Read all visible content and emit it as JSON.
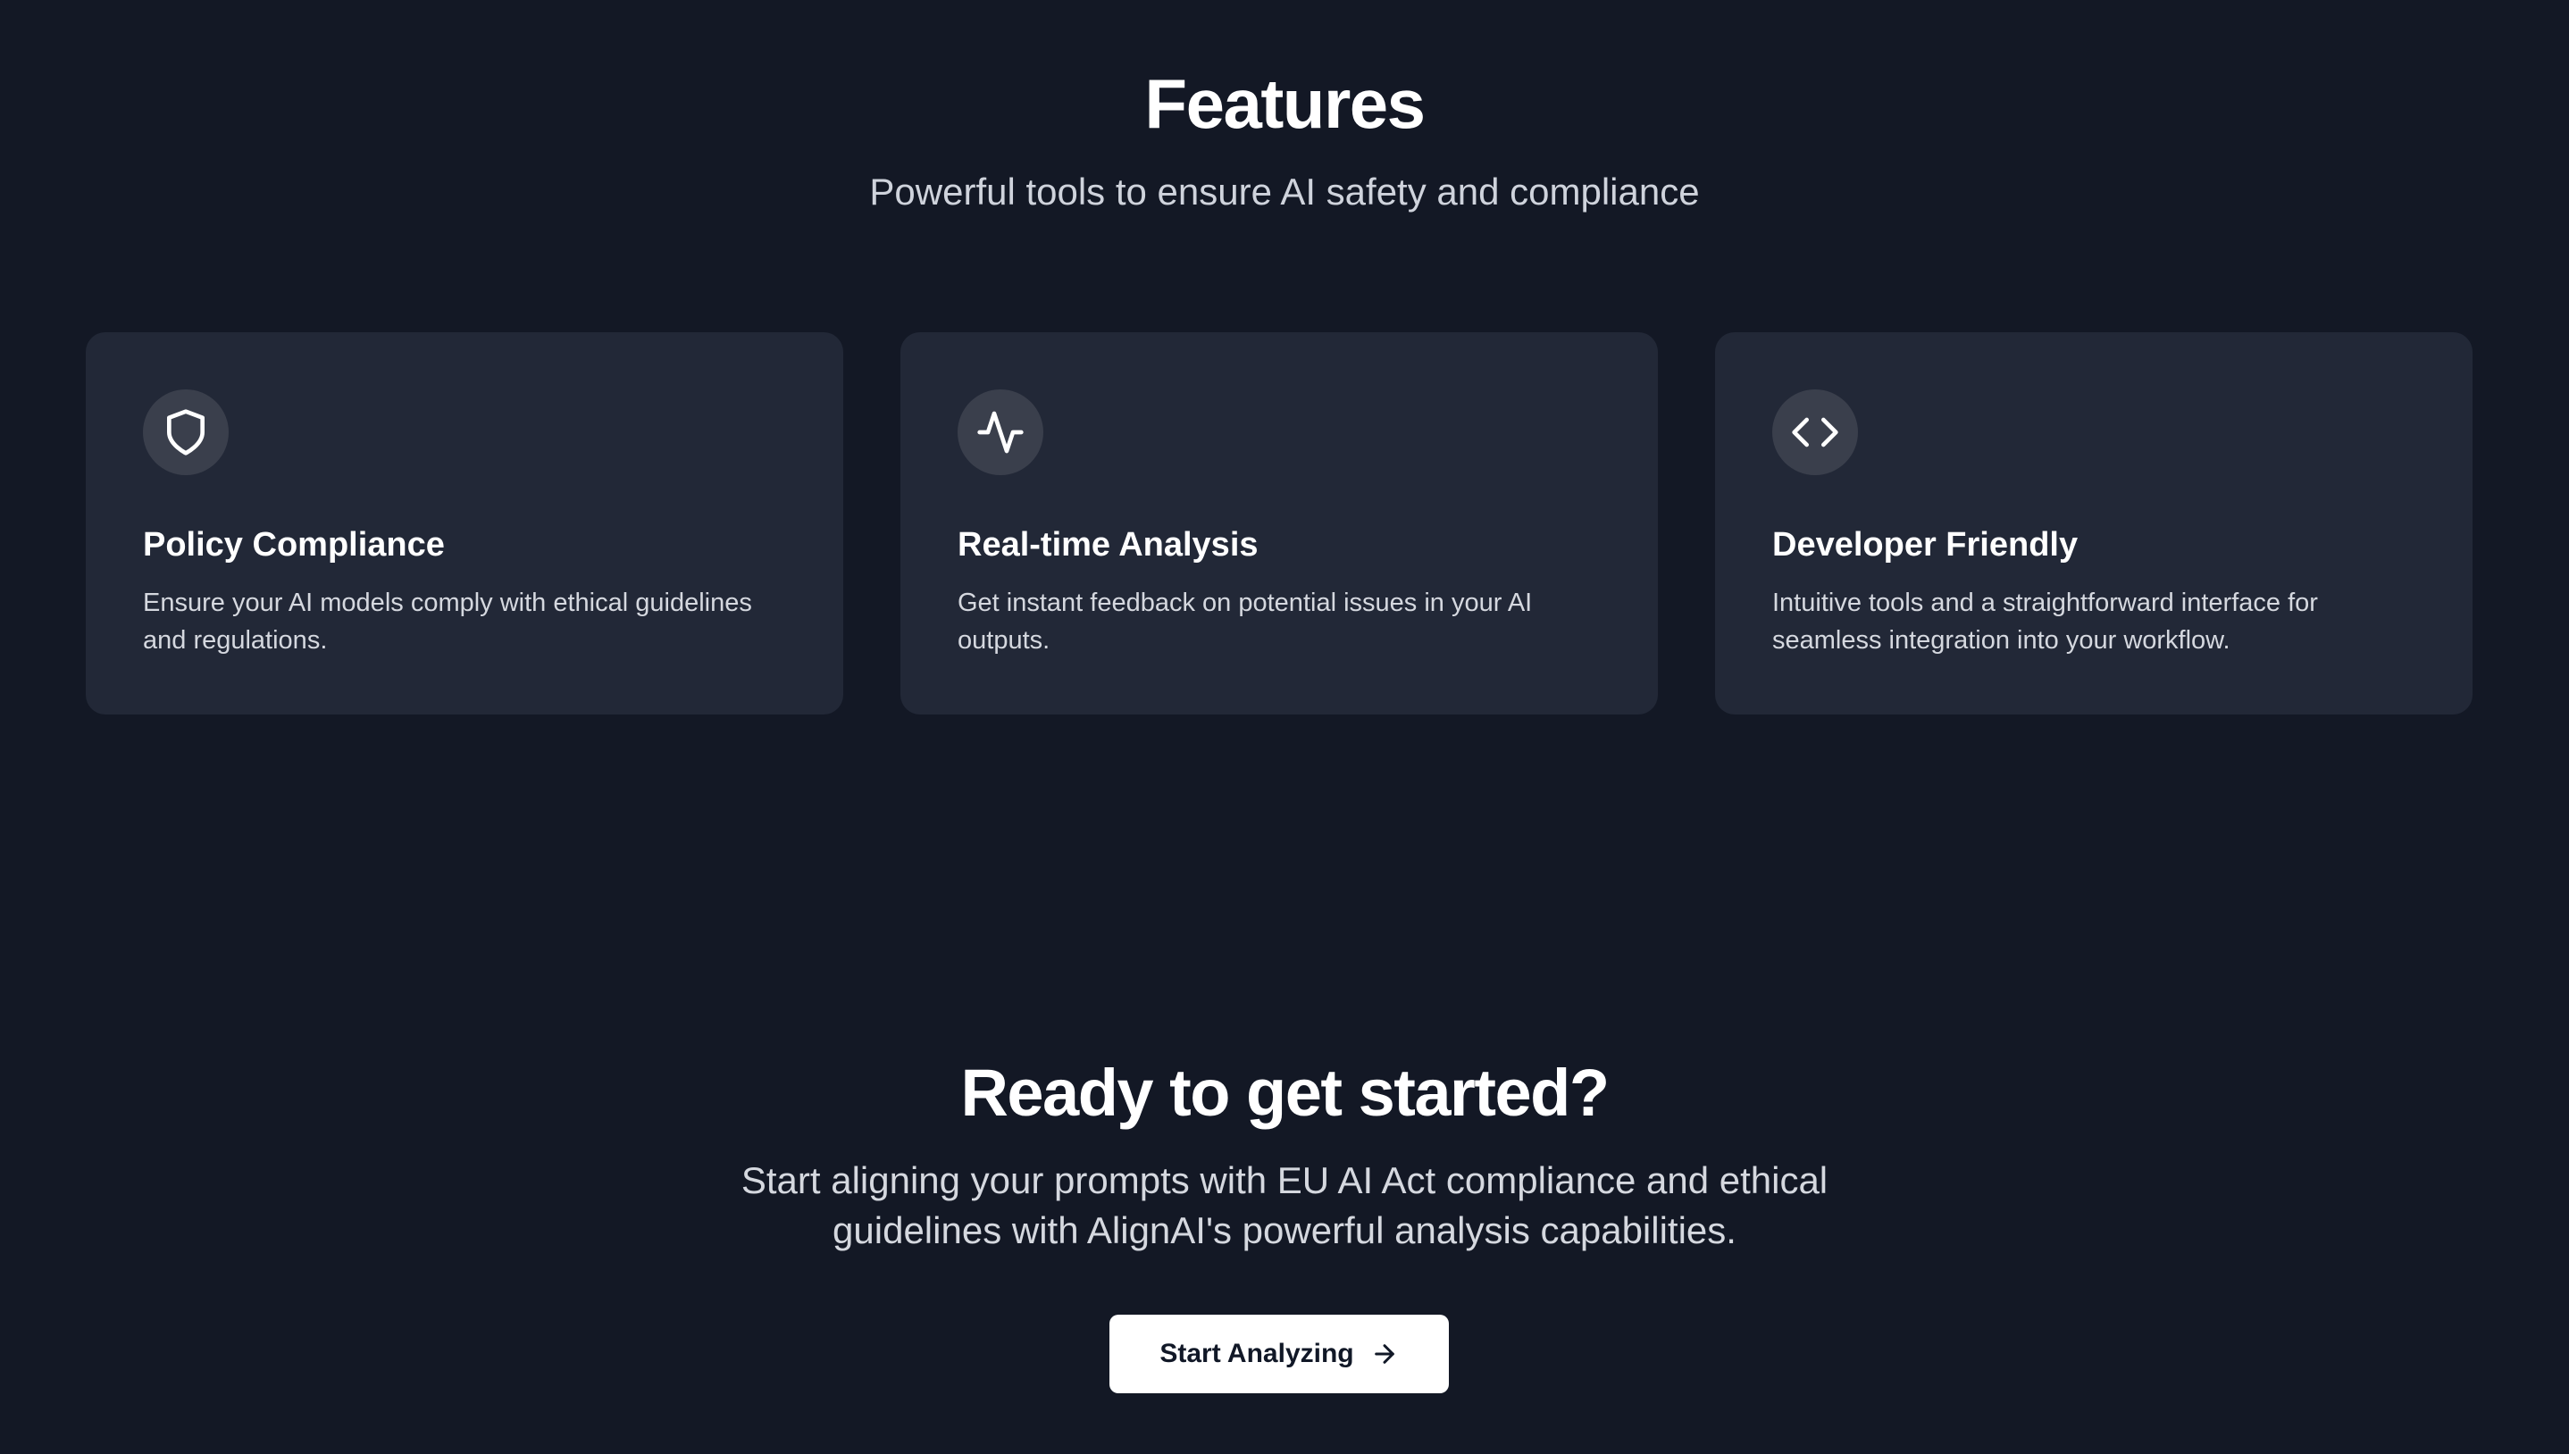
{
  "features": {
    "title": "Features",
    "subtitle": "Powerful tools to ensure AI safety and compliance",
    "cards": [
      {
        "icon": "shield-icon",
        "title": "Policy Compliance",
        "description": "Ensure your AI models comply with ethical guidelines and regulations."
      },
      {
        "icon": "activity-icon",
        "title": "Real-time Analysis",
        "description": "Get instant feedback on potential issues in your AI outputs."
      },
      {
        "icon": "code-icon",
        "title": "Developer Friendly",
        "description": "Intuitive tools and a straightforward interface for seamless integration into your workflow."
      }
    ]
  },
  "cta": {
    "title": "Ready to get started?",
    "text": "Start aligning your prompts with EU AI Act compliance and ethical guidelines with AlignAI's powerful analysis capabilities.",
    "button_label": "Start Analyzing",
    "button_icon": "arrow-right-icon"
  },
  "colors": {
    "background": "#131825",
    "card_background": "#222837",
    "icon_circle": "#3a3f4c",
    "button_background": "#ffffff",
    "button_text": "#111827"
  }
}
